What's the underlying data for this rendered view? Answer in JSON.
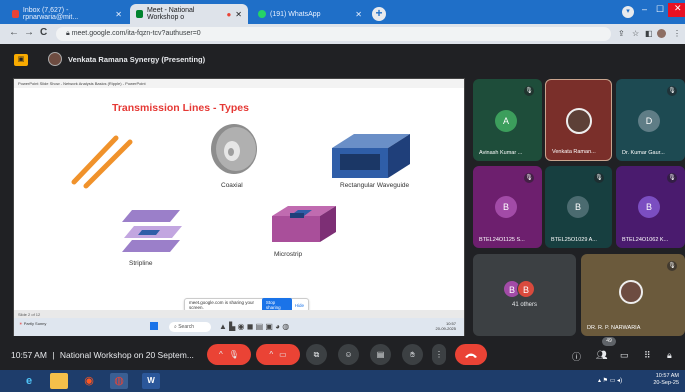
{
  "browser": {
    "tabs": [
      {
        "label": "Inbox (7,627) - rpnarwaria@mit...",
        "active": false,
        "icon_color": "#ea4335"
      },
      {
        "label": "Meet - National Workshop o",
        "active": true,
        "icon_color": "#00832d"
      },
      {
        "label": "(191) WhatsApp",
        "active": false,
        "icon_color": "#25d366"
      }
    ],
    "url": "meet.google.com/ita-fqzn-tcv?authuser=0",
    "new_tab_label": "+",
    "nav": {
      "back": "←",
      "forward": "→",
      "reload": "C"
    },
    "window_controls": {
      "minimize": "–",
      "maximize": "☐",
      "close": "✕"
    }
  },
  "meet": {
    "presenter_label": "Venkata Ramana Synergy (Presenting)",
    "meeting_time": "10:57 AM",
    "meeting_separator": "|",
    "meeting_title": "National Workshop on 20 Septem...",
    "participant_count_badge": "49",
    "leave_icon": "phone-hangup-icon",
    "tiles": [
      {
        "name": "Avinash Kumar ...",
        "initial": "A",
        "bg": "#1e4d3a",
        "avatar_color": "#3c9e5c",
        "muted": true
      },
      {
        "name": "Venkata Raman...",
        "initial": "",
        "bg": "#7a2f2a",
        "avatar_color": "#5d4037",
        "muted": false,
        "has_photo": true
      },
      {
        "name": "Dr. Kumar Gaur...",
        "initial": "D",
        "bg": "#1d4a52",
        "avatar_color": "#5f7d86",
        "muted": true
      },
      {
        "name": "BTEL24O1125 S...",
        "initial": "B",
        "bg": "#6d1f6e",
        "avatar_color": "#a24ba7",
        "muted": true
      },
      {
        "name": "BTEL25O1029 A...",
        "initial": "B",
        "bg": "#173f40",
        "avatar_color": "#4b6b70",
        "muted": true
      },
      {
        "name": "BTEL24O1062 K...",
        "initial": "B",
        "bg": "#4a1b6e",
        "avatar_color": "#7b4ec1",
        "muted": true
      },
      {
        "name": "41 others",
        "initial": "B",
        "bg": "#3c4043",
        "avatar_color": "#a24ba7",
        "muted": false
      },
      {
        "name": "DR. R. P. NARWARIA",
        "initial": "",
        "bg": "#6b5a3c",
        "avatar_color": "#6d4c41",
        "muted": true,
        "has_photo": true
      }
    ]
  },
  "slide": {
    "title": "Transmission Lines - Types",
    "labels": {
      "coaxial": "Coaxial",
      "waveguide": "Rectangular Waveguide",
      "stripline": "Stripline",
      "microstrip": "Microstrip"
    },
    "ppt_title": "PowerPoint Slide Show - Network Analysis Basics (Ripple) - PowerPoint",
    "ppt_status": "Slide 2 of 12",
    "share_note": "meet.google.com is sharing your screen.",
    "stop_sharing": "Stop sharing",
    "hide": "Hide",
    "weather": "Partly Sunny",
    "search_placeholder": "Search",
    "taskbar_time": "10:57",
    "taskbar_date": "20-09-2025"
  },
  "os": {
    "time": "10:57 AM",
    "date": "20-Sep-25"
  }
}
